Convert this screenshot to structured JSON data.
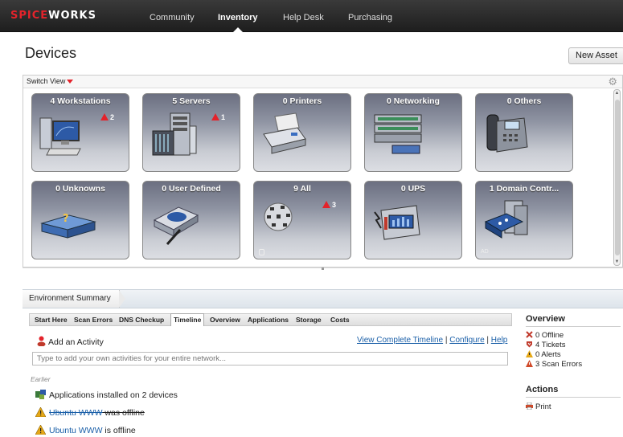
{
  "topbar": {
    "logo_a": "SPICE",
    "logo_b": "WORKS",
    "nav": [
      {
        "label": "Community",
        "active": false
      },
      {
        "label": "Inventory",
        "active": true
      },
      {
        "label": "Help Desk",
        "active": false
      },
      {
        "label": "Purchasing",
        "active": false
      }
    ]
  },
  "page": {
    "title": "Devices",
    "new_asset": "New Asset",
    "switch_view": "Switch View"
  },
  "tiles": [
    {
      "label": "4 Workstations",
      "alert": "2"
    },
    {
      "label": "5 Servers",
      "alert": "1"
    },
    {
      "label": "0 Printers",
      "alert": ""
    },
    {
      "label": "0 Networking",
      "alert": ""
    },
    {
      "label": "0 Others",
      "alert": ""
    },
    {
      "label": "0 Unknowns",
      "alert": ""
    },
    {
      "label": "0 User Defined",
      "alert": ""
    },
    {
      "label": "9 All",
      "alert": "3"
    },
    {
      "label": "0 UPS",
      "alert": ""
    },
    {
      "label": "1 Domain Contr...",
      "alert": "",
      "badge": "AD"
    }
  ],
  "env": {
    "tab": "Environment Summary",
    "tabs": [
      {
        "label": "Start Here",
        "selected": false
      },
      {
        "label": "Scan Errors",
        "selected": false
      },
      {
        "label": "DNS Checkup",
        "selected": false
      },
      {
        "label": "Timeline",
        "selected": true
      },
      {
        "label": "Overview",
        "selected": false
      },
      {
        "label": "Applications",
        "selected": false
      },
      {
        "label": "Storage",
        "selected": false
      },
      {
        "label": "Costs",
        "selected": false
      }
    ],
    "add_activity": "Add an Activity",
    "links": {
      "timeline": "View Complete Timeline",
      "configure": "Configure",
      "help": "Help",
      "sep": "|"
    },
    "input_placeholder": "Type to add your own activities for your entire network...",
    "earlier": "Earlier",
    "events": [
      {
        "icon": "apps-icon",
        "prefix": "",
        "link": "",
        "text": "Applications installed on 2 devices"
      },
      {
        "icon": "warning-icon",
        "prefix": "",
        "link": "Ubuntu WWW",
        "text": " was offline",
        "strike": true
      },
      {
        "icon": "warning-icon",
        "prefix": "",
        "link": "Ubuntu WWW",
        "text": " is offline",
        "strike": false
      }
    ]
  },
  "overview": {
    "title": "Overview",
    "items": [
      {
        "icon": "offline-icon",
        "label": "0 Offline",
        "color": "#c0392b"
      },
      {
        "icon": "ticket-icon",
        "label": "4 Tickets",
        "color": "#c0392b"
      },
      {
        "icon": "alert-icon",
        "label": "0 Alerts",
        "color": "#e6a817"
      },
      {
        "icon": "scan-error-icon",
        "label": "3 Scan Errors",
        "color": "#d04a2a"
      }
    ]
  },
  "actions": {
    "title": "Actions",
    "print": "Print"
  },
  "colors": {
    "brand": "#e4232b",
    "link": "#1a5fa8"
  }
}
